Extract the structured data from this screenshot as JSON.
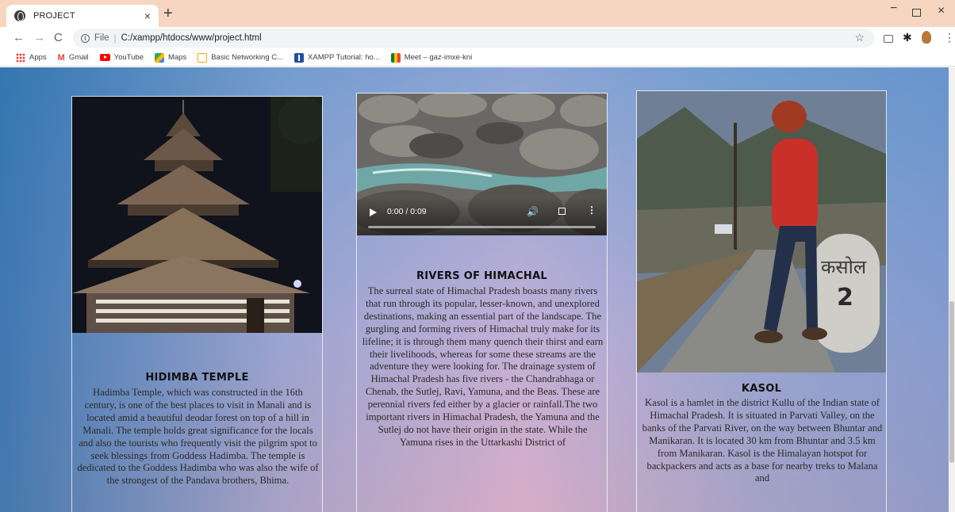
{
  "browser": {
    "tab_title": "PROJECT",
    "tab_close": "×",
    "new_tab": "+",
    "window": {
      "minimize": "−",
      "close": "×"
    },
    "nav": {
      "back": "←",
      "forward": "→",
      "reload": "C"
    },
    "address": {
      "scheme": "File",
      "separator": "|",
      "url": "C:/xampp/htdocs/www/project.html"
    },
    "icons": {
      "star": "☆",
      "puzzle": "✱",
      "menu": "⋮",
      "info": "i"
    },
    "bookmarks": [
      {
        "label": "Apps",
        "icon": "apps-icon"
      },
      {
        "label": "Gmail",
        "icon": "gmail-icon",
        "glyph": "M"
      },
      {
        "label": "YouTube",
        "icon": "youtube-icon"
      },
      {
        "label": "Maps",
        "icon": "maps-icon"
      },
      {
        "label": "Basic Networking C...",
        "icon": "circle-icon"
      },
      {
        "label": "XAMPP Tutorial: ho...",
        "icon": "xampp-icon"
      },
      {
        "label": "Meet – gaz-imxe-kni",
        "icon": "meet-icon"
      }
    ]
  },
  "cards": [
    {
      "title": "HIDIMBA TEMPLE",
      "text": "Hadimba Temple, which was constructed in the 16th century, is one of the best places to visit in Manali and is located amid a beautiful deodar forest on top of a hill in Manali. The temple holds great significance for the locals and also the tourists who frequently visit the pilgrim spot to seek blessings from Goddess Hadimba. The temple is dedicated to the Goddess Hadimba who was also the wife of the strongest of the Pandava brothers, Bhima."
    },
    {
      "title": "RIVERS OF HIMACHAL",
      "text": "The surreal state of Himachal Pradesh boasts many rivers that run through its popular, lesser-known, and unexplored destinations, making an essential part of the landscape. The gurgling and forming rivers of Himachal truly make for its lifeline; it is through them many quench their thirst and earn their livelihoods, whereas for some these streams are the adventure they were looking for. The drainage system of Himachal Pradesh has five rivers - the Chandrabhaga or Chenab, the Sutlej, Ravi, Yamuna, and the Beas. These are perennial rivers fed either by a glacier or rainfall.The two important rivers in Himachal Pradesh, the Yamuna and the Sutlej do not have their origin in the state. While the Yamuna rises in the Uttarkashi District of",
      "video": {
        "time": "0:00 / 0:09",
        "progress": 0,
        "volume_icon": "🔊",
        "menu_icon": "⋮"
      }
    },
    {
      "title": "KASOL",
      "text": "Kasol is a hamlet in the district Kullu of the Indian state of Himachal Pradesh. It is situated in Parvati Valley, on the banks of the Parvati River, on the way between Bhuntar and Manikaran. It is located 30 km from Bhuntar and 3.5 km from Manikaran. Kasol is the Himalayan hotspot for backpackers and acts as a base for nearby treks to Malana and",
      "milestone": {
        "text": "कसोल",
        "number": "2"
      }
    }
  ]
}
